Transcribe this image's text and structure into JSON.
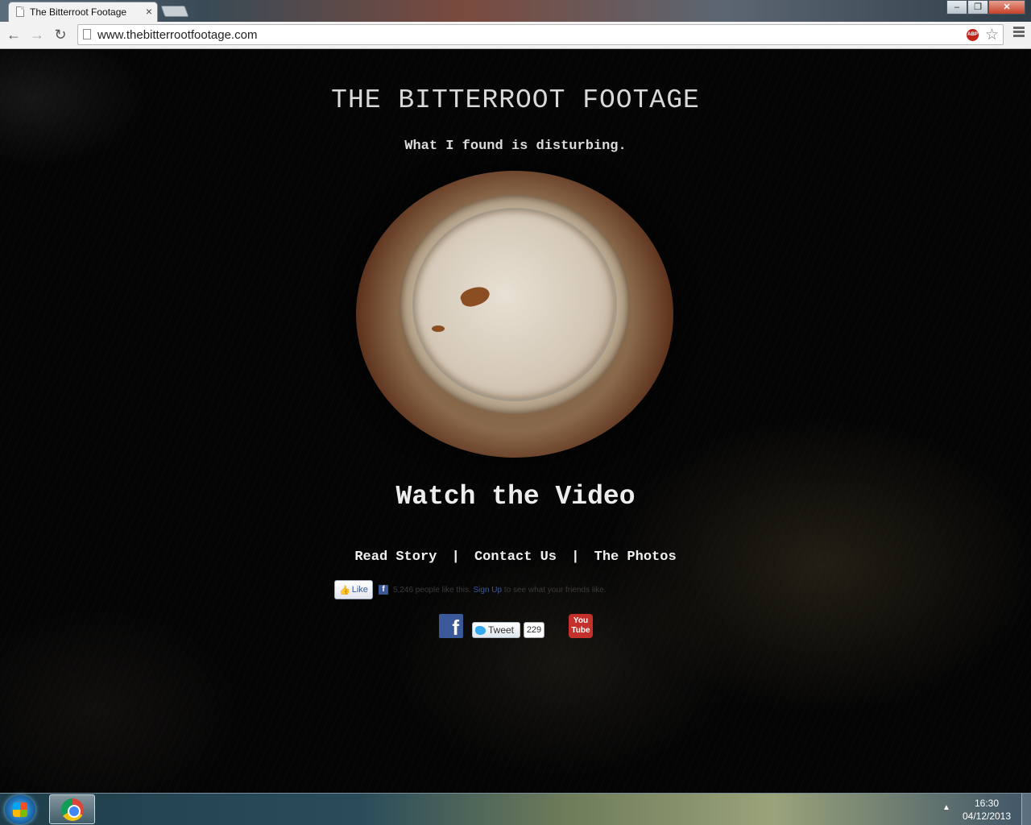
{
  "browser": {
    "tab_title": "The Bitterroot Footage",
    "tab_close": "×",
    "url": "www.thebitterrootfootage.com",
    "abp_label": "ABP",
    "window_controls": {
      "minimize": "–",
      "maximize": "❐",
      "close": "✕"
    }
  },
  "page": {
    "site_title": "THE BITTERROOT FOOTAGE",
    "tagline": "What I found is disturbing.",
    "cta": "Watch the Video",
    "nav": [
      {
        "label": "Read Story"
      },
      {
        "label": "Contact Us"
      },
      {
        "label": "The Photos"
      }
    ],
    "nav_separator": "|",
    "facebook_like": {
      "button_label": "Like",
      "count_text": "5,246 people like this.",
      "signup": "Sign Up",
      "suffix": "to see what your friends like."
    },
    "social": {
      "facebook_glyph": "f",
      "tweet_label": "Tweet",
      "tweet_count": "229",
      "youtube_label": "You Tube"
    }
  },
  "taskbar": {
    "time": "16:30",
    "date": "04/12/2013",
    "tray_arrow": "▲"
  },
  "icons": [
    "page-icon",
    "back-icon",
    "forward-icon",
    "reload-icon",
    "adblock-icon",
    "star-icon",
    "menu-icon",
    "facebook-icon",
    "twitter-icon",
    "youtube-icon",
    "windows-start-icon",
    "chrome-icon"
  ]
}
